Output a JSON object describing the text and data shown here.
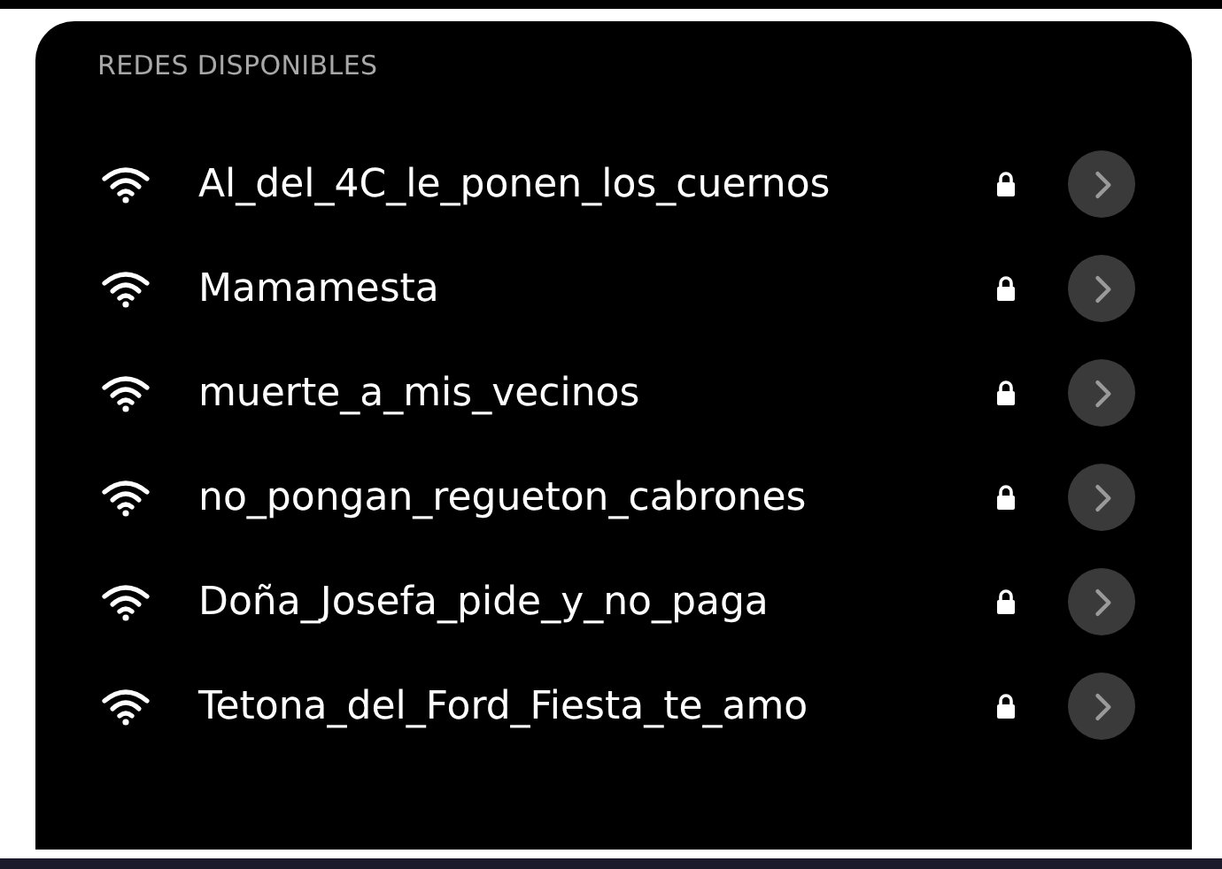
{
  "section_title": "REDES DISPONIBLES",
  "networks": [
    {
      "name": "Al_del_4C_le_ponen_los_cuernos",
      "secured": true
    },
    {
      "name": "Mamamesta",
      "secured": true
    },
    {
      "name": "muerte_a_mis_vecinos",
      "secured": true
    },
    {
      "name": "no_pongan_regueton_cabrones",
      "secured": true
    },
    {
      "name": "Doña_Josefa_pide_y_no_paga",
      "secured": true
    },
    {
      "name": "Tetona_del_Ford_Fiesta_te_amo",
      "secured": true
    }
  ]
}
